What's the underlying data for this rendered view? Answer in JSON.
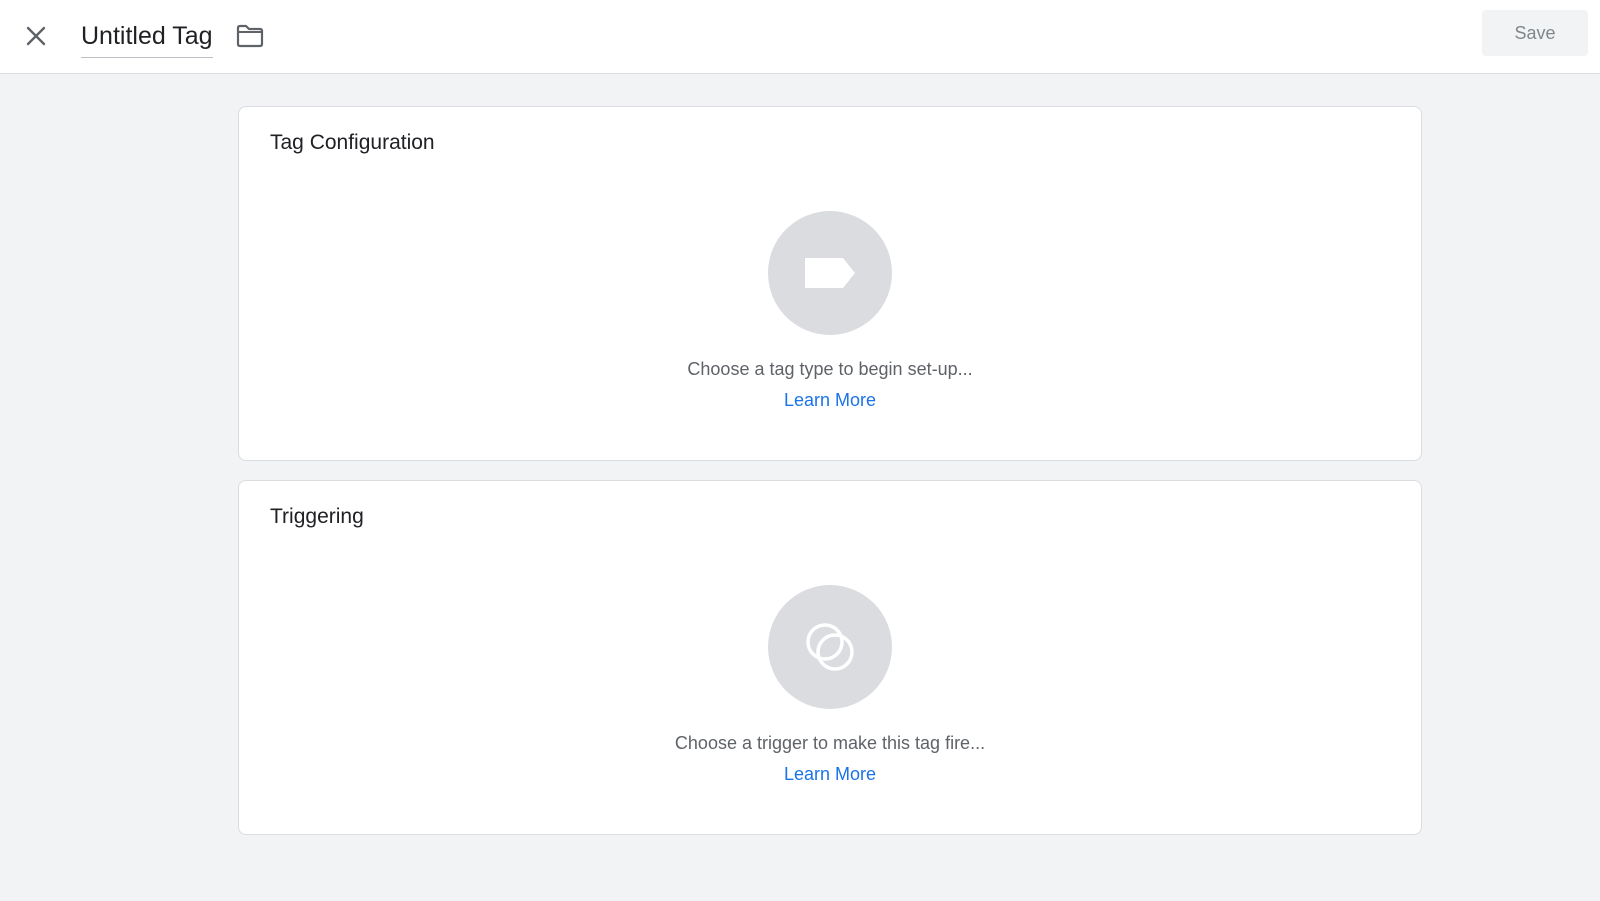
{
  "header": {
    "title": "Untitled Tag",
    "save_label": "Save"
  },
  "tag_configuration": {
    "title": "Tag Configuration",
    "description": "Choose a tag type to begin set-up...",
    "link": "Learn More"
  },
  "triggering": {
    "title": "Triggering",
    "description": "Choose a trigger to make this tag fire...",
    "link": "Learn More"
  },
  "icons": {
    "close": "close-icon",
    "folder": "folder-icon",
    "tag": "tag-icon",
    "trigger": "trigger-icon"
  },
  "colors": {
    "background": "#f1f3f4",
    "link": "#1a73e8",
    "icon_circle": "#dadce0",
    "save_text": "#80868b"
  }
}
